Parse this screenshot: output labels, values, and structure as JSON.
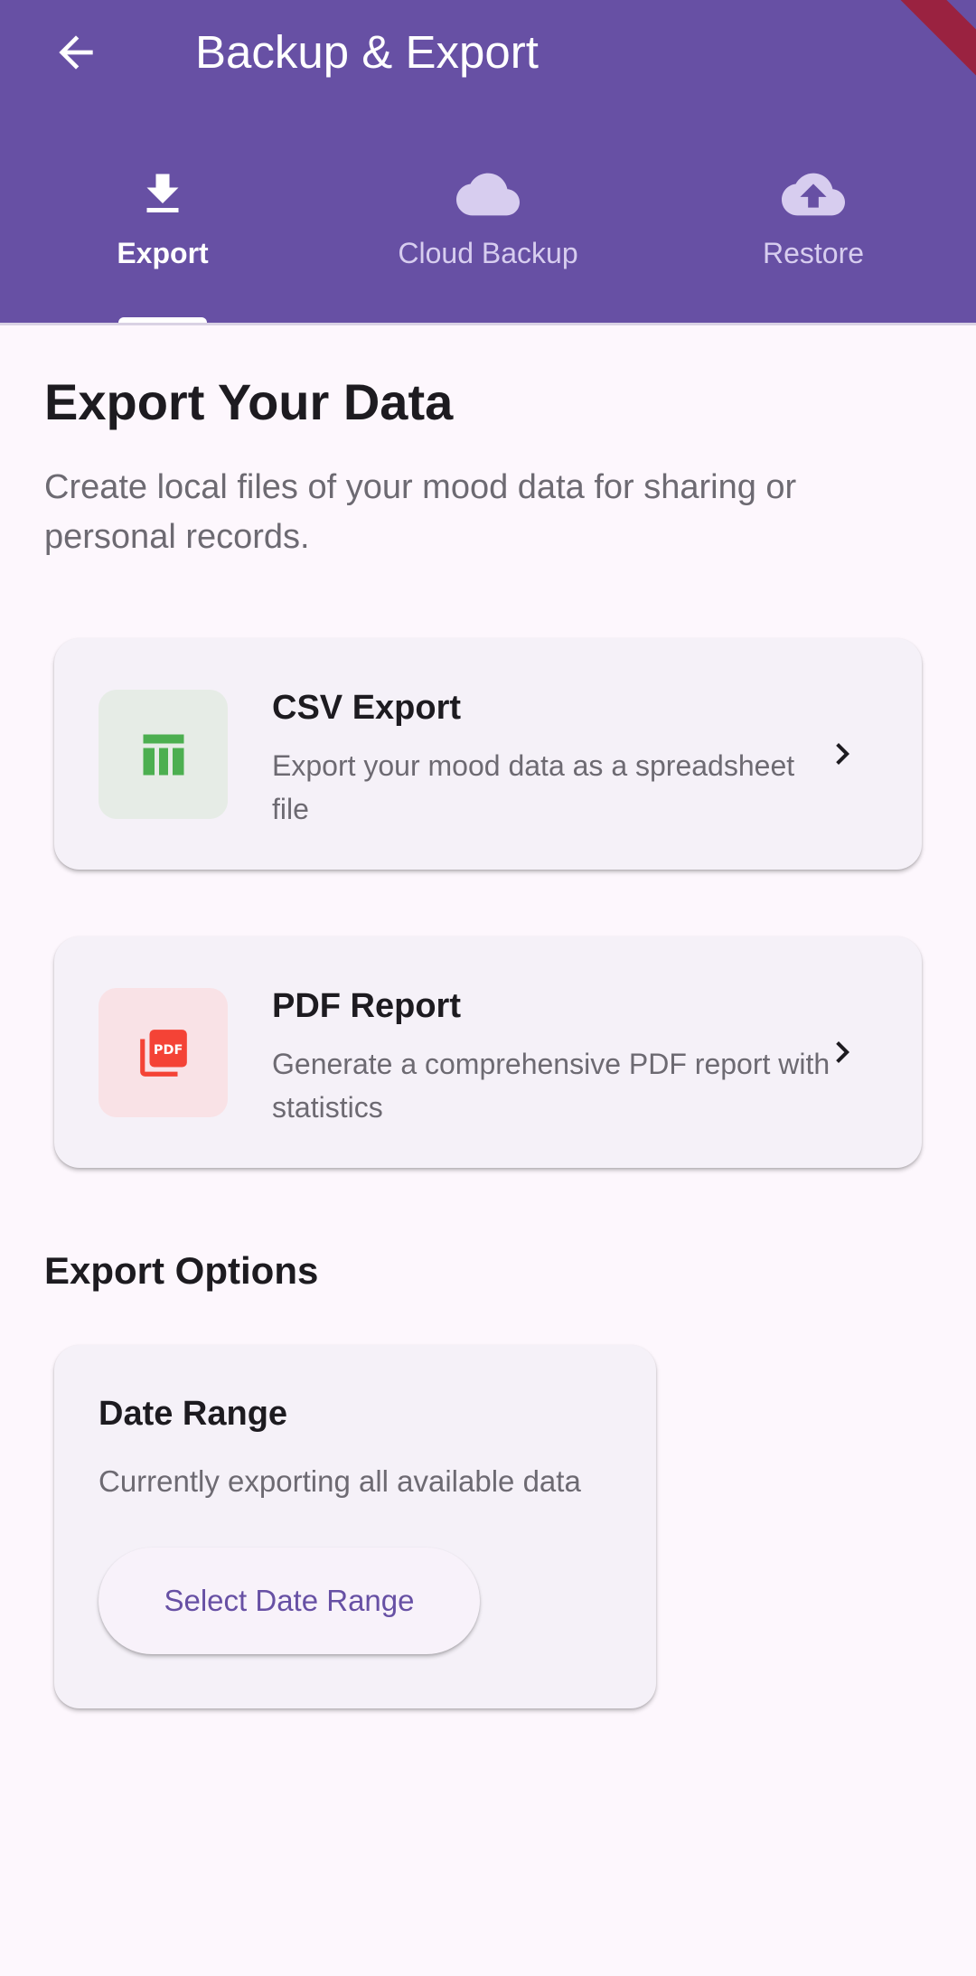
{
  "appbar": {
    "title": "Backup & Export",
    "back_icon": "arrow-back-icon",
    "background": "#6750a4"
  },
  "tabs": [
    {
      "label": "Export",
      "icon": "download-icon",
      "active": true
    },
    {
      "label": "Cloud Backup",
      "icon": "cloud-icon",
      "active": false
    },
    {
      "label": "Restore",
      "icon": "cloud-upload-icon",
      "active": false
    }
  ],
  "export": {
    "title": "Export Your Data",
    "description": "Create local files of your mood data for sharing or personal records.",
    "cards": [
      {
        "title": "CSV Export",
        "description": "Export your mood data as a spreadsheet file",
        "icon": "table-icon",
        "icon_color": "#4caf50",
        "icon_bg": "#e6ece6"
      },
      {
        "title": "PDF Report",
        "description": "Generate a comprehensive PDF report with statistics",
        "icon": "pdf-icon",
        "icon_color": "#f44336",
        "icon_bg": "#f9e2e6"
      }
    ]
  },
  "options": {
    "title": "Export Options",
    "date_range": {
      "title": "Date Range",
      "description": "Currently exporting all available data",
      "button_label": "Select Date Range"
    }
  },
  "colors": {
    "primary": "#6750a4",
    "background": "#fdf7fd",
    "card": "#f5f1f8"
  }
}
